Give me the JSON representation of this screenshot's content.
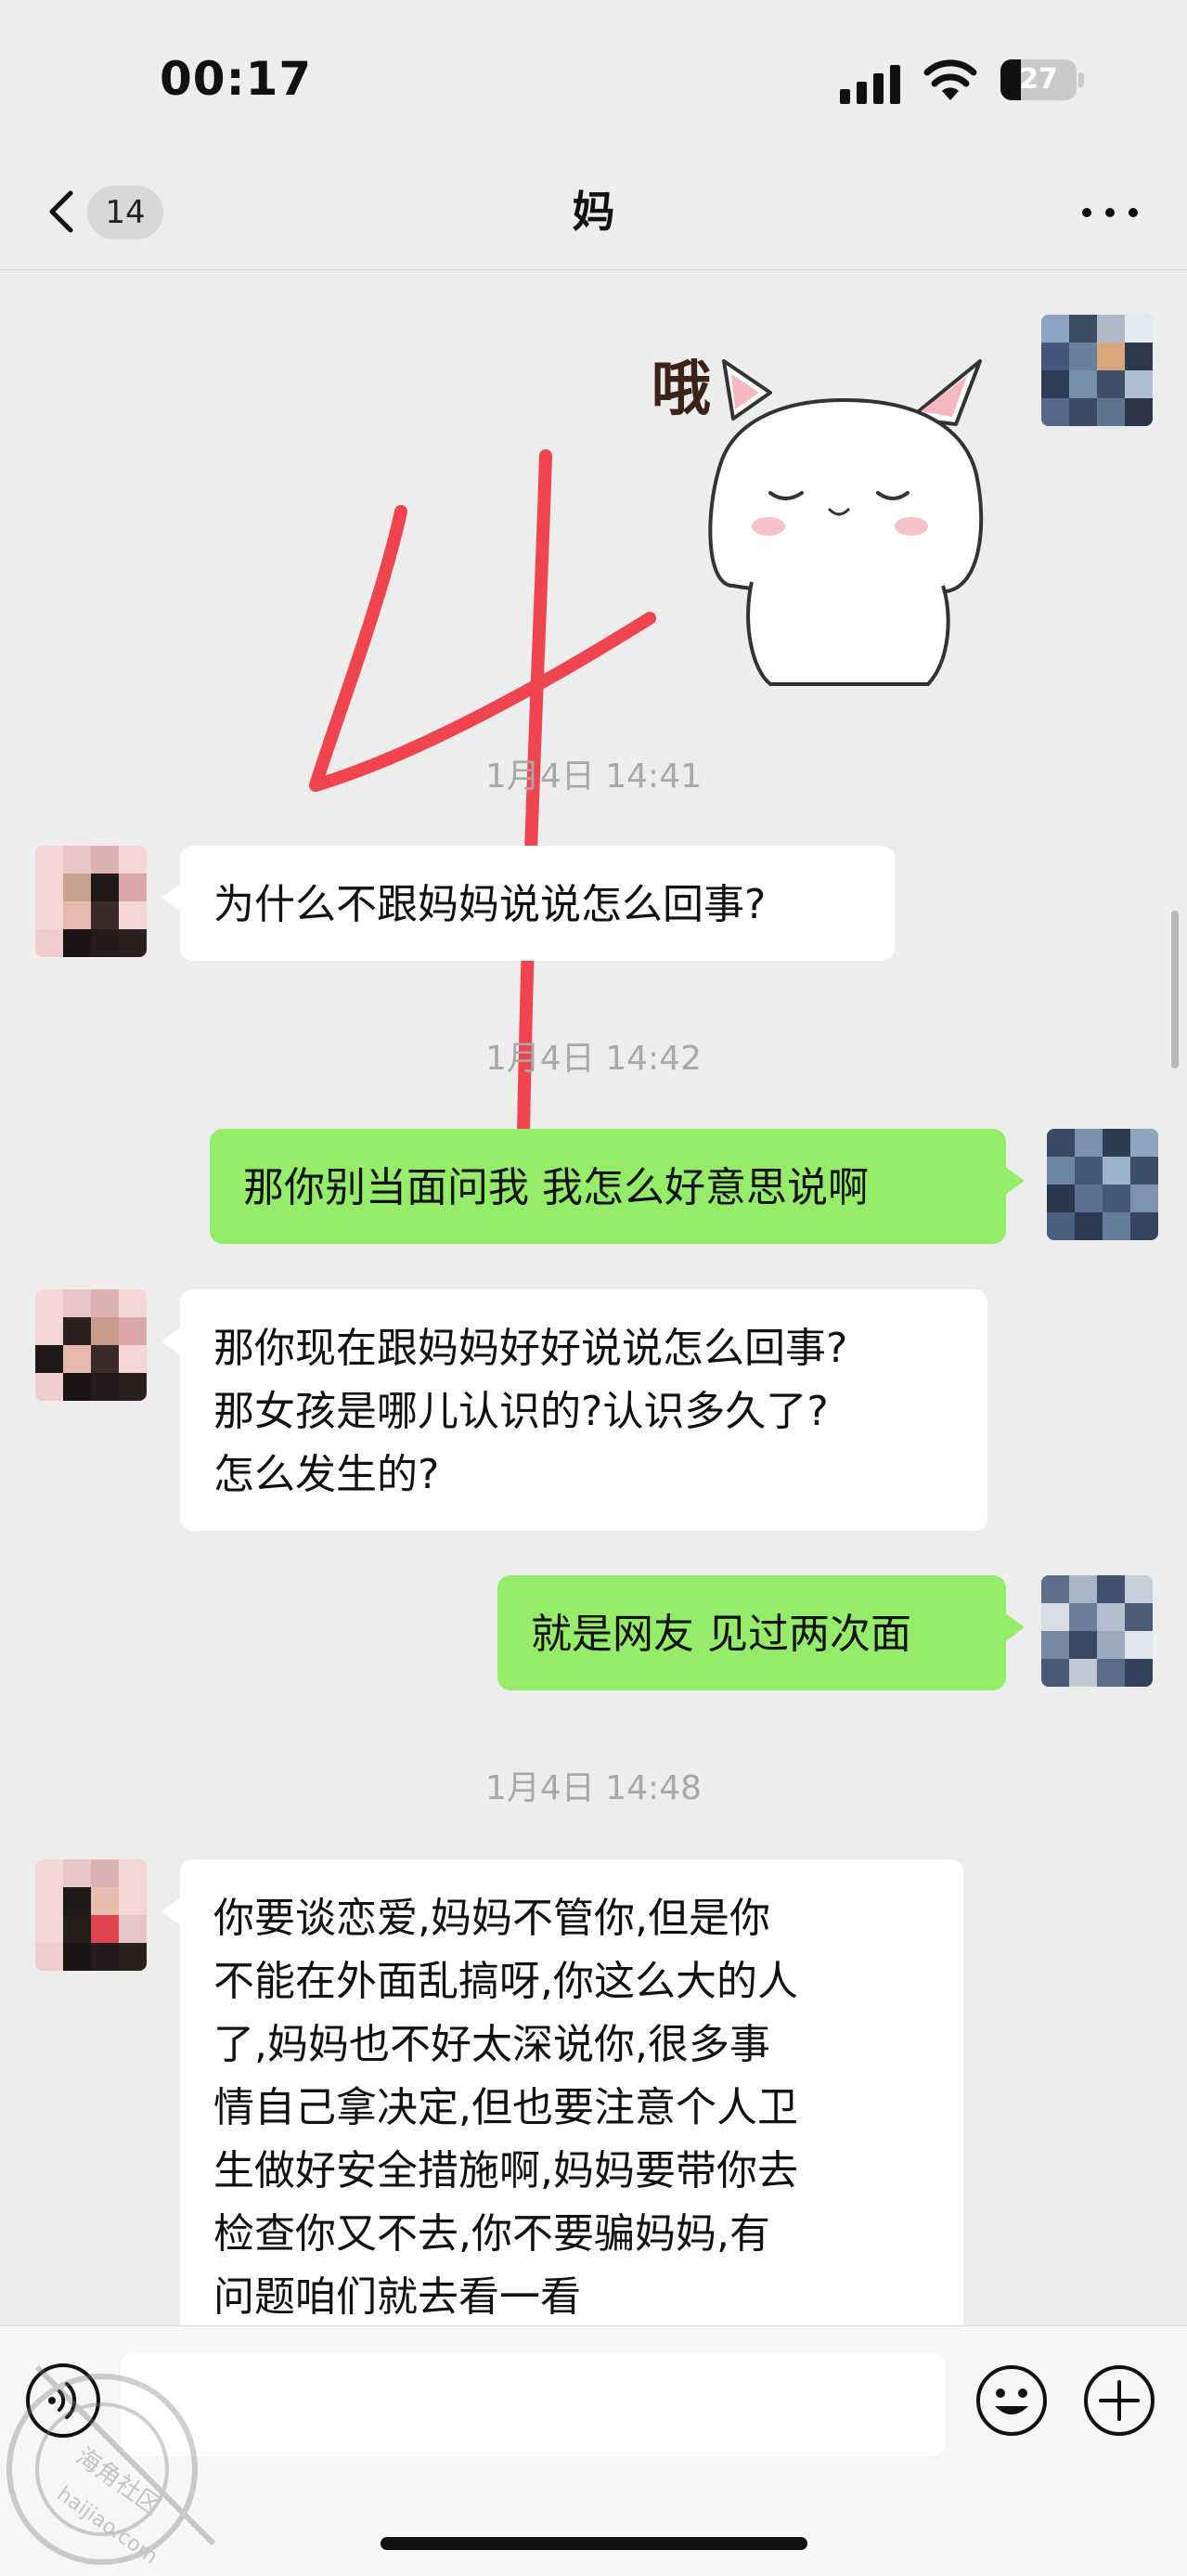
{
  "status_bar": {
    "time": "00:17",
    "battery_level": "27"
  },
  "nav_bar": {
    "unread_count": "14",
    "title": "妈"
  },
  "sticker": {
    "caption": "哦",
    "overlay": "4"
  },
  "messages": [
    {
      "type": "timestamp",
      "text": "1月4日 14:41"
    },
    {
      "type": "received",
      "lines": [
        "为什么不跟妈妈说说怎么回事?"
      ]
    },
    {
      "type": "timestamp",
      "text": "1月4日 14:42"
    },
    {
      "type": "sent",
      "lines": [
        "那你别当面问我 我怎么好意思说啊"
      ]
    },
    {
      "type": "received",
      "lines": [
        "那你现在跟妈妈好好说说怎么回事?",
        "那女孩是哪儿认识的?认识多久了?",
        "怎么发生的?"
      ]
    },
    {
      "type": "sent",
      "lines": [
        "就是网友 见过两次面"
      ]
    },
    {
      "type": "timestamp",
      "text": "1月4日 14:48"
    },
    {
      "type": "received",
      "lines": [
        "你要谈恋爱,妈妈不管你,但是你",
        "不能在外面乱搞呀,你这么大的人",
        "了,妈妈也不好太深说你,很多事",
        "情自己拿决定,但也要注意个人卫",
        "生做好安全措施啊,妈妈要带你去",
        "检查你又不去,你不要骗妈妈,有",
        "问题咱们就去看一看"
      ]
    }
  ],
  "input_bar": {
    "value": ""
  },
  "watermark": {
    "line1": "海角社区",
    "line2": "haijiao.com"
  },
  "colors": {
    "background": "#ededed",
    "sent_bubble": "#95ec69",
    "received_bubble": "#ffffff",
    "timestamp": "#a8a8a8",
    "overlay_stroke": "#f0444f"
  }
}
